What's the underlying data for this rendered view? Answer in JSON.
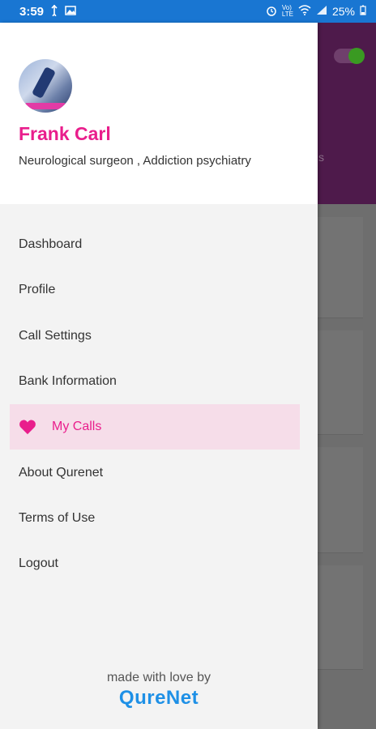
{
  "status_bar": {
    "time": "3:59",
    "battery": "25%",
    "indicators": [
      "usb-icon",
      "image-icon",
      "alarm-icon",
      "volte-icon",
      "wifi-icon",
      "signal-icon",
      "battery-icon"
    ]
  },
  "profile": {
    "name": "Frank Carl",
    "specialty": "Neurological surgeon , Addiction psychiatry"
  },
  "menu": {
    "items": [
      {
        "label": "Dashboard"
      },
      {
        "label": "Profile"
      },
      {
        "label": "Call Settings"
      },
      {
        "label": "Bank Information"
      },
      {
        "label": "My Calls",
        "icon": "heart-icon",
        "active": true
      },
      {
        "label": "About Qurenet"
      },
      {
        "label": "Terms of Use"
      },
      {
        "label": "Logout"
      }
    ]
  },
  "footer": {
    "tagline": "made with love by",
    "brand": "QureNet"
  },
  "colors": {
    "accent": "#e91e8c",
    "status_bar": "#1976d2",
    "active_bg": "#f6dde9",
    "brand": "#1e90e6",
    "app_header": "#4e1a4b"
  },
  "background_app": {
    "header_partial_text": "s"
  }
}
